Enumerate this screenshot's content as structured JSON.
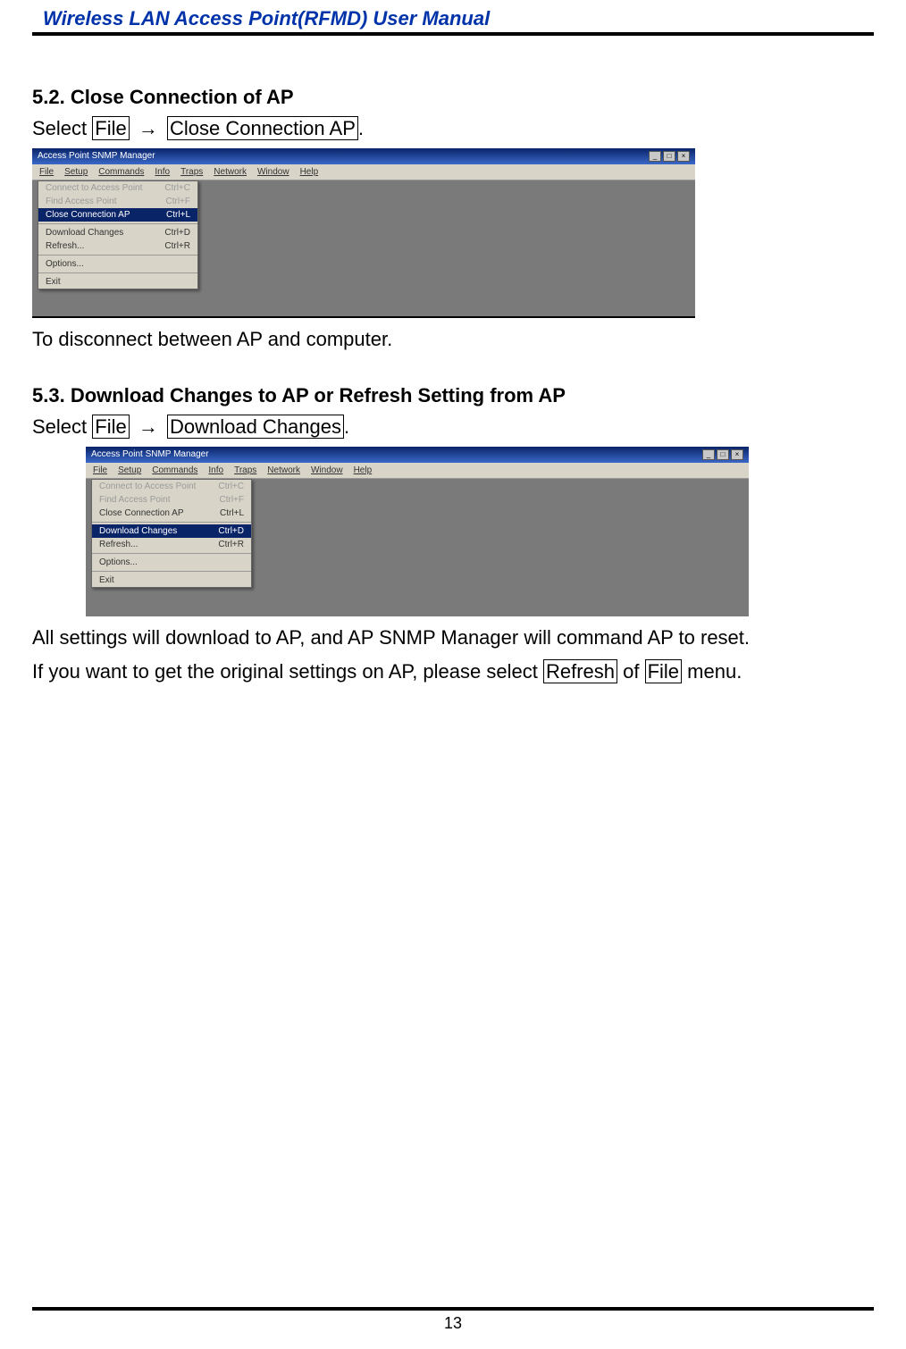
{
  "doc": {
    "title": "Wireless LAN Access Point(RFMD) User Manual",
    "page_number": "13"
  },
  "section_5_2": {
    "number": "5.2.",
    "title": "Close Connection of AP",
    "select_label": "Select",
    "file_label": "File",
    "arrow": "→",
    "action_label": "Close Connection AP",
    "period": ".",
    "caption": "To disconnect between AP and computer."
  },
  "section_5_3": {
    "number": "5.3.",
    "title": "Download Changes to AP or Refresh Setting from AP",
    "select_label": "Select",
    "file_label": "File",
    "arrow": "→",
    "action_label": "Download Changes",
    "period": ".",
    "line1": "All settings will download to AP, and AP SNMP Manager will command AP to reset.",
    "line2_pre": "If you want to get the original settings on AP, please select ",
    "refresh_label": "Refresh",
    "line2_mid": " of ",
    "file_label2": "File",
    "line2_post": " menu."
  },
  "screenshot1": {
    "window_title": "Access Point SNMP Manager",
    "menubar": [
      "File",
      "Setup",
      "Commands",
      "Info",
      "Traps",
      "Network",
      "Window",
      "Help"
    ],
    "items": [
      {
        "label": "Connect to Access Point",
        "shortcut": "Ctrl+C",
        "state": "disabled"
      },
      {
        "label": "Find Access Point",
        "shortcut": "Ctrl+F",
        "state": "disabled"
      },
      {
        "label": "Close Connection AP",
        "shortcut": "Ctrl+L",
        "state": "highlight"
      },
      {
        "label": "Download Changes",
        "shortcut": "Ctrl+D",
        "state": "normal"
      },
      {
        "label": "Refresh...",
        "shortcut": "Ctrl+R",
        "state": "normal"
      },
      {
        "label": "Options...",
        "shortcut": "",
        "state": "normal"
      },
      {
        "label": "Exit",
        "shortcut": "",
        "state": "normal"
      }
    ]
  },
  "screenshot2": {
    "window_title": "Access Point SNMP Manager",
    "menubar": [
      "File",
      "Setup",
      "Commands",
      "Info",
      "Traps",
      "Network",
      "Window",
      "Help"
    ],
    "items": [
      {
        "label": "Connect to Access Point",
        "shortcut": "Ctrl+C",
        "state": "disabled"
      },
      {
        "label": "Find Access Point",
        "shortcut": "Ctrl+F",
        "state": "disabled"
      },
      {
        "label": "Close Connection AP",
        "shortcut": "Ctrl+L",
        "state": "normal"
      },
      {
        "label": "Download Changes",
        "shortcut": "Ctrl+D",
        "state": "highlight"
      },
      {
        "label": "Refresh...",
        "shortcut": "Ctrl+R",
        "state": "normal"
      },
      {
        "label": "Options...",
        "shortcut": "",
        "state": "normal"
      },
      {
        "label": "Exit",
        "shortcut": "",
        "state": "normal"
      }
    ]
  }
}
